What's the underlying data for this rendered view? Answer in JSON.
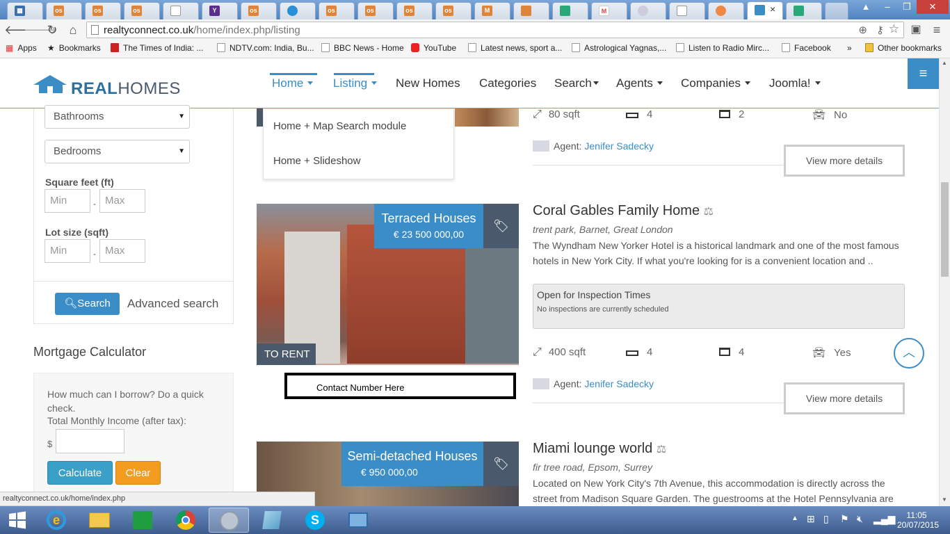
{
  "browser": {
    "url_domain": "realtyconnect.co.uk",
    "url_path": "/home/index.php/listing",
    "active_tab_close": "×",
    "window_buttons": [
      "–",
      "❐",
      "✕"
    ],
    "tab_favicons": [
      "os",
      "os",
      "os",
      "Y",
      "os",
      "os",
      "os",
      "os",
      "os",
      "M"
    ]
  },
  "bookmarks": [
    {
      "label": "Apps"
    },
    {
      "label": "Bookmarks"
    },
    {
      "label": "The Times of India: ..."
    },
    {
      "label": "NDTV.com: India, Bu..."
    },
    {
      "label": "BBC News - Home"
    },
    {
      "label": "YouTube"
    },
    {
      "label": "Latest news, sport a..."
    },
    {
      "label": "Astrological Yagnas,..."
    },
    {
      "label": "Listen to Radio Mirc..."
    },
    {
      "label": "Facebook"
    },
    {
      "label": "»"
    },
    {
      "label": "Other bookmarks"
    }
  ],
  "site": {
    "logo_bold": "REAL",
    "logo_light": "HOMES",
    "nav": [
      "Home",
      "Listing",
      "New Homes",
      "Categories",
      "Search",
      "Agents",
      "Companies",
      "Joomla!"
    ],
    "home_dropdown": [
      "Home + Map Search module",
      "Home + Slideshow"
    ]
  },
  "sidebar": {
    "bathrooms": "Bathrooms",
    "bedrooms": "Bedrooms",
    "sqft_label": "Square feet (ft)",
    "lot_label": "Lot size (sqft)",
    "min_placeholder": "Min",
    "max_placeholder": "Max",
    "dash": "-",
    "search_button": "Search",
    "advanced_search": "Advanced search",
    "mortgage_title": "Mortgage Calculator",
    "mortgage_question": "How much can I borrow? Do a quick check.",
    "income_label": "Total Monthly Income (after tax):",
    "currency": "$",
    "calculate": "Calculate",
    "clear": "Clear"
  },
  "listings": {
    "top": {
      "sqft": "80 sqft",
      "beds": "4",
      "baths": "2",
      "garage": "No",
      "agent_prefix": "Agent:",
      "agent_name": "Jenifer Sadecky",
      "more": "View more details"
    },
    "coral": {
      "category": "Terraced Houses",
      "price": "€ 23 500 000,00",
      "status": "TO RENT",
      "title": "Coral Gables Family Home",
      "address": "trent park, Barnet, Great London",
      "description": "The Wyndham New Yorker Hotel is a historical landmark and one of the most famous hotels in New York City. If what you're looking for is a convenient location and ..",
      "inspection_title": "Open for Inspection Times",
      "inspection_text": "No inspections are currently scheduled",
      "sqft": "400 sqft",
      "beds": "4",
      "baths": "4",
      "garage": "Yes",
      "agent_prefix": "Agent:",
      "agent_name": "Jenifer Sadecky",
      "more": "View more details",
      "contact": "Contact Number Here"
    },
    "miami": {
      "category": "Semi-detached Houses",
      "price": "€ 950 000,00",
      "title": "Miami lounge world",
      "address": "fir tree road, Epsom, Surrey",
      "description": "Located on New York City's 7th Avenue, this accommodation is directly across the street from Madison Square Garden. The guestrooms at the Hotel Pennsylvania are"
    }
  },
  "status_bar": "realtyconnect.co.uk/home/index.php",
  "taskbar": {
    "time": "11:05",
    "date": "20/07/2015"
  },
  "colors": {
    "accent": "#3a8dc7",
    "tag_dark": "#4a5a6c",
    "calculate": "#3aa0c8",
    "clear": "#f39c1f"
  }
}
